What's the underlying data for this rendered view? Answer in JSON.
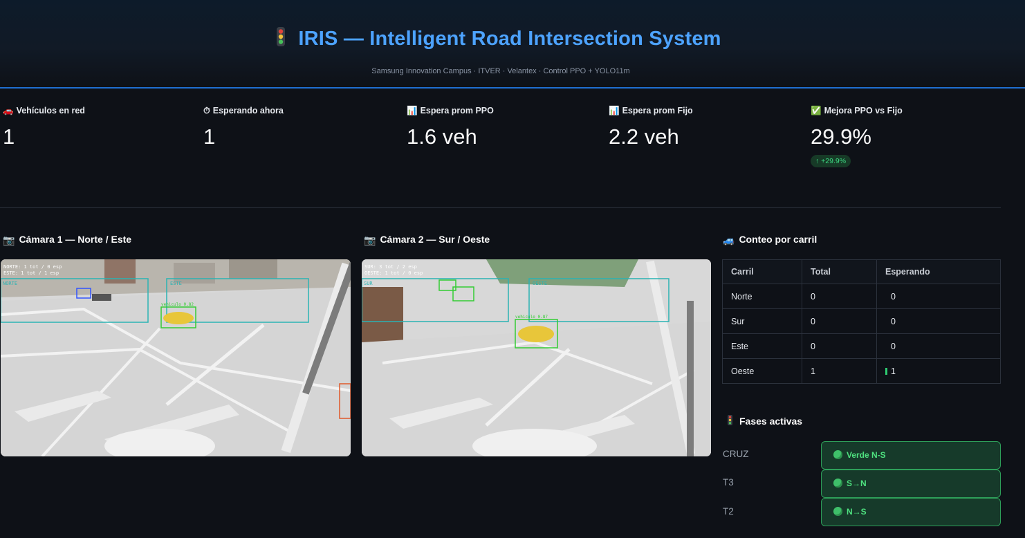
{
  "header": {
    "title": "IRIS — Intelligent Road Intersection System",
    "subtitle": "Samsung Innovation Campus · ITVER · Velantex · Control PPO + YOLO11m",
    "accent_color": "#4da3ff"
  },
  "metrics": [
    {
      "icon": "car-icon",
      "glyph": "🚗",
      "label": "Vehículos en red",
      "value": "1"
    },
    {
      "icon": "stopwatch-icon",
      "glyph": "⏱",
      "label": "Esperando ahora",
      "value": "1"
    },
    {
      "icon": "bar-chart-icon",
      "glyph": "📊",
      "label": "Espera prom PPO",
      "value": "1.6 veh"
    },
    {
      "icon": "bar-chart-icon",
      "glyph": "📊",
      "label": "Espera prom Fijo",
      "value": "2.2 veh"
    },
    {
      "icon": "check-icon",
      "glyph": "✅",
      "label": "Mejora PPO vs Fijo",
      "value": "29.9%",
      "delta": "↑ +29.9%"
    }
  ],
  "cameras": [
    {
      "glyph": "📷",
      "title": "Cámara 1 — Norte / Este",
      "overlay_line1": "NORTE: 1 tot / 0 esp",
      "overlay_line2": "ESTE: 1 tot / 1 esp",
      "zone_a": "NORTE",
      "zone_b": "ESTE",
      "det_label": "vehiculo 0.82"
    },
    {
      "glyph": "📷",
      "title": "Cámara 2 — Sur / Oeste",
      "overlay_line1": "SUR: 3 tot / 2 esp",
      "overlay_line2": "OESTE: 1 tot / 0 esp",
      "zone_a": "SUR",
      "zone_b": "OESTE",
      "det_label": "vehiculo 0.87"
    }
  ],
  "lanes": {
    "glyph": "🚙",
    "title": "Conteo por carril",
    "headers": [
      "Carril",
      "Total",
      "Esperando"
    ],
    "rows": [
      {
        "lane": "Norte",
        "total": "0",
        "waiting": "0",
        "bar": false
      },
      {
        "lane": "Sur",
        "total": "0",
        "waiting": "0",
        "bar": false
      },
      {
        "lane": "Este",
        "total": "0",
        "waiting": "0",
        "bar": false
      },
      {
        "lane": "Oeste",
        "total": "1",
        "waiting": "1",
        "bar": true
      }
    ]
  },
  "phases": {
    "title": "Fases activas",
    "items": [
      {
        "label": "CRUZ",
        "state": "Verde N-S"
      },
      {
        "label": "T3",
        "state": "S→N"
      },
      {
        "label": "T2",
        "state": "N→S"
      }
    ],
    "chip_color": "#4ee07f"
  }
}
